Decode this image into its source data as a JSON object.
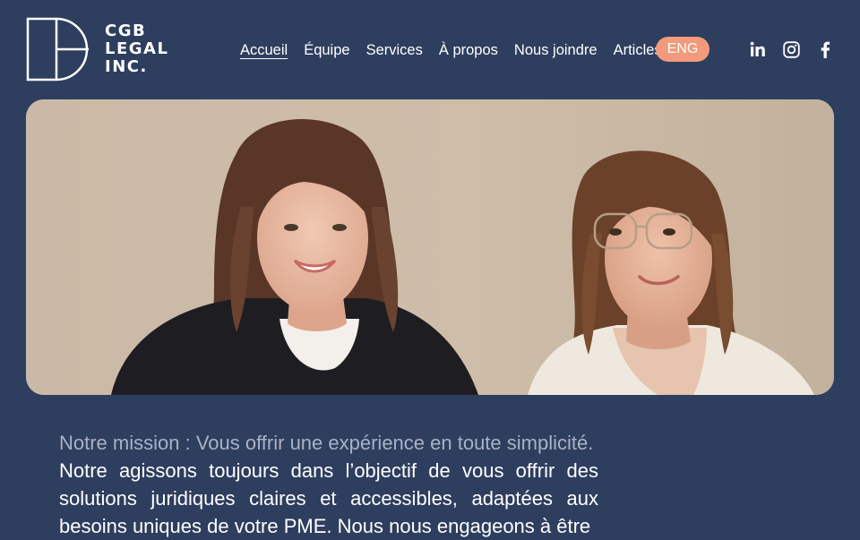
{
  "brand": {
    "lines": [
      "CGB",
      "LEGAL",
      "INC."
    ]
  },
  "nav": {
    "items": [
      {
        "label": "Accueil",
        "active": true
      },
      {
        "label": "Équipe"
      },
      {
        "label": "Services"
      },
      {
        "label": "À propos"
      },
      {
        "label": "Nous joindre"
      },
      {
        "label": "Articles"
      }
    ],
    "language_button": "ENG"
  },
  "social": {
    "icons": [
      "linkedin-icon",
      "instagram-icon",
      "facebook-icon"
    ]
  },
  "colors": {
    "background": "#2e3e5e",
    "accent": "#f29a7b",
    "muted_text": "#aab1c4"
  },
  "mission": {
    "title": "Notre mission : Vous offrir une expérience en toute simplicité.",
    "body": "Notre agissons toujours dans l’objectif de vous offrir des solutions juridiques claires et accessibles, adaptées aux besoins uniques de votre PME. Nous nous engageons à être"
  }
}
